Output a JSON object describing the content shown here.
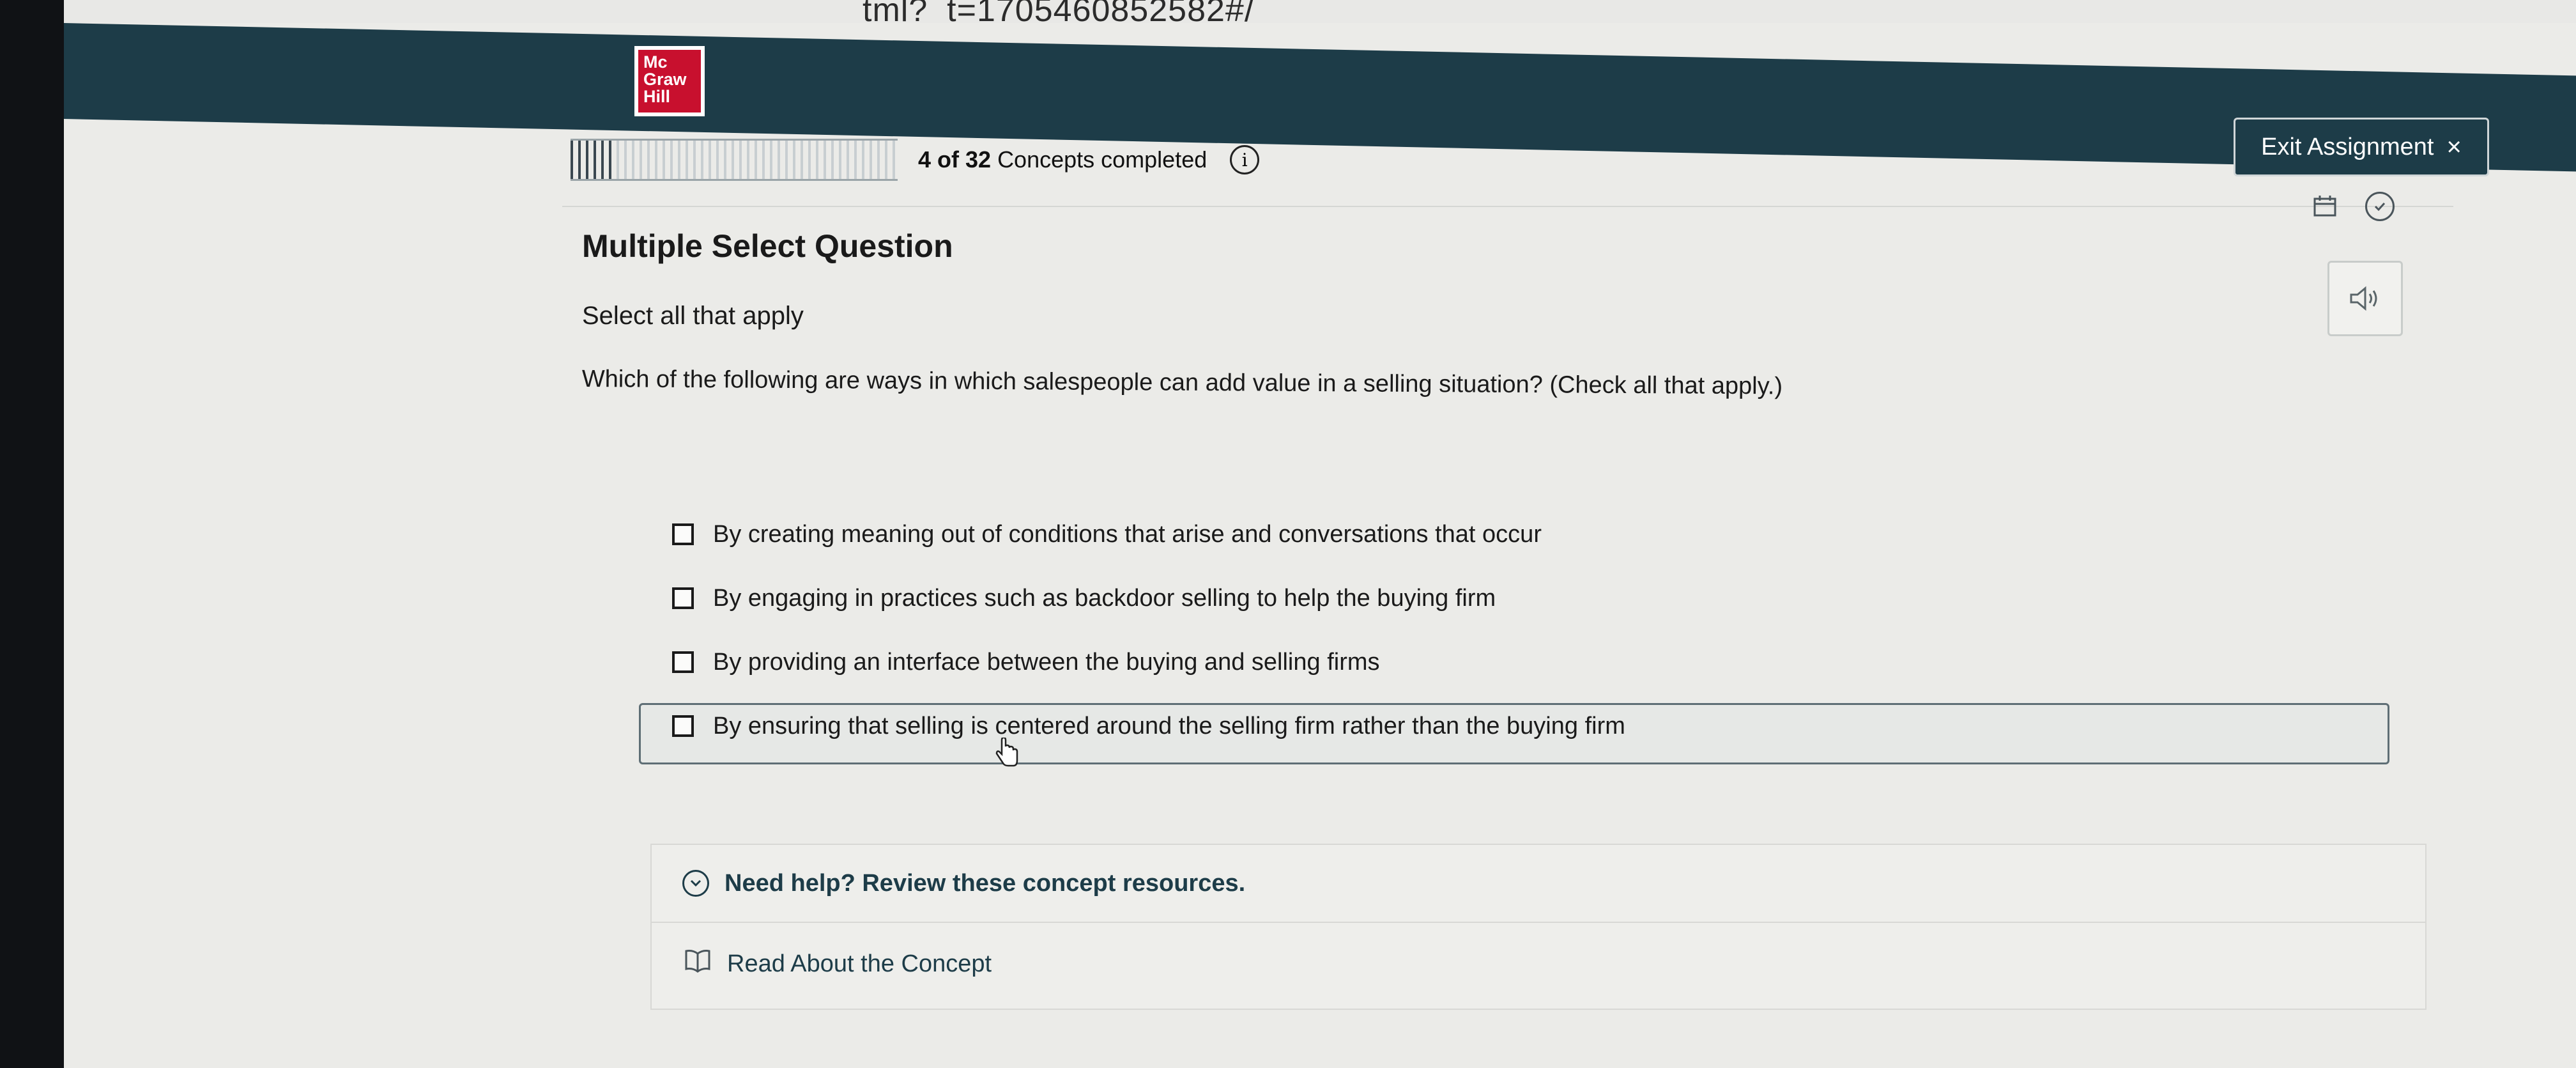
{
  "browser": {
    "url_fragment": "tml?_t=1705460852582#/"
  },
  "header": {
    "logo_lines": [
      "Mc",
      "Graw",
      "Hill"
    ],
    "exit_label": "Exit Assignment",
    "exit_icon": "×"
  },
  "progress": {
    "count_text": "4 of 32",
    "label": "Concepts completed",
    "completed": 4,
    "total": 32,
    "info_icon": "i"
  },
  "question": {
    "type": "Multiple Select Question",
    "instruction": "Select all that apply",
    "prompt": "Which of the following are ways in which salespeople can add value in a selling situation? (Check all that apply.)",
    "options": [
      "By creating meaning out of conditions that arise and conversations that occur",
      "By engaging in practices such as backdoor selling to help the buying firm",
      "By providing an interface between the buying and selling firms",
      "By ensuring that selling is centered around the selling firm rather than the buying firm"
    ]
  },
  "help": {
    "title": "Need help? Review these concept resources.",
    "read_label": "Read About the Concept"
  }
}
